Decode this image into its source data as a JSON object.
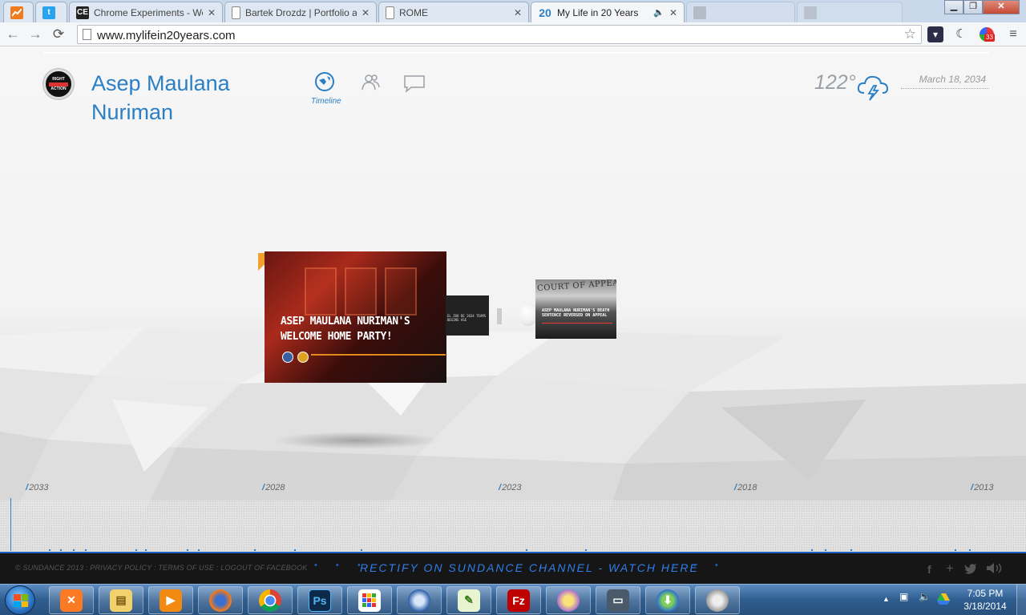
{
  "browser": {
    "tabs": [
      {
        "label": "",
        "icon": "analytics-icon"
      },
      {
        "label": "",
        "icon": "twitter-icon"
      },
      {
        "label": "Chrome Experiments - We",
        "icon": "chrome-experiments-icon",
        "fav_text": "CE"
      },
      {
        "label": "Bartek Drozdz | Portfolio a",
        "icon": "page-icon"
      },
      {
        "label": "ROME",
        "icon": "page-icon"
      },
      {
        "label": "My Life in 20 Years",
        "icon": "twenty-icon",
        "fav_text": "20",
        "active": true,
        "audio": "🔈"
      },
      {
        "label": "",
        "icon": "faded-tab-icon"
      },
      {
        "label": "",
        "icon": "faded-tab-icon"
      }
    ],
    "url": "www.mylifein20years.com",
    "extension_badge": "33"
  },
  "site": {
    "profile_name_line1": "Asep Maulana",
    "profile_name_line2": "Nuriman",
    "avatar_text_1": "RIGHT",
    "avatar_text_2": "ACTION",
    "nav_active_label": "Timeline",
    "temperature": "122°",
    "date": "March 18, 2034",
    "weather_icon": "thunderstorm-cloud-icon",
    "cards": {
      "main_title": "Asep Maulana Nuriman's Welcome Home Party!",
      "small_text": "EL ZOO DE 2034 TEAMS BEGINS ASE",
      "right_header": "COURT OF APPEALS",
      "right_title": "Asep Maulana Nuriman's Death Sentence Reversed on Appeal"
    },
    "timeline_years": [
      "2033",
      "2028",
      "2023",
      "2018",
      "2013"
    ],
    "accent_color": "#2a7fc6"
  },
  "footer": {
    "links_text": "© SUNDANCE 2013 : PRIVACY POLICY : TERMS OF USE : LOGOUT OF FACEBOOK",
    "marquee_dots": "• • •",
    "marquee": "RECTIFY ON SUNDANCE CHANNEL - WATCH HERE",
    "marquee_dots_after": "• • •",
    "social": [
      "facebook-icon",
      "plus-icon",
      "twitter-icon",
      "sound-icon"
    ]
  },
  "taskbar": {
    "apps": [
      "xampp-icon",
      "file-explorer-icon",
      "media-player-icon",
      "firefox-icon",
      "chrome-icon",
      "photoshop-icon",
      "app-grid-icon",
      "thunderbird-icon",
      "notepad-plus-icon",
      "filezilla-icon",
      "messenger-icon",
      "monitor-icon",
      "download-manager-icon",
      "speaker-app-icon"
    ],
    "photoshop_label": "Ps",
    "filezilla_label": "Fz",
    "time": "7:05 PM",
    "date": "3/18/2014"
  }
}
